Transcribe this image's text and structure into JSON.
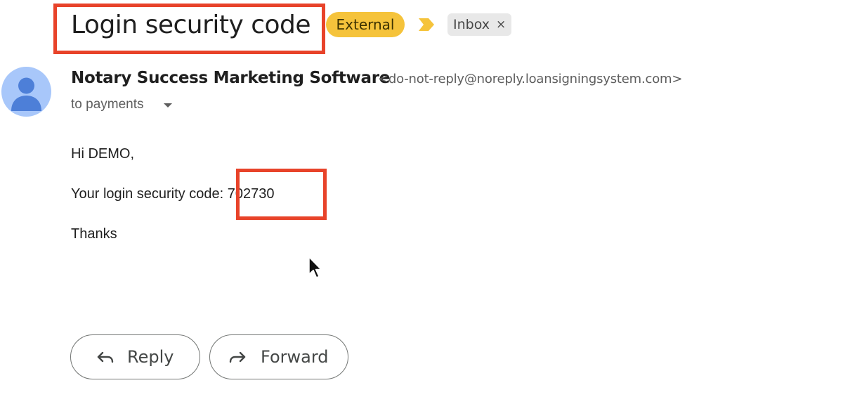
{
  "email": {
    "subject": "Login security code",
    "labels": {
      "external": "External",
      "inbox": "Inbox",
      "remove_symbol": "×"
    },
    "sender": {
      "name": "Notary Success Marketing Software",
      "email": "<do-not-reply@noreply.loansigningsystem.com>",
      "recipient": "to payments"
    },
    "body": {
      "greeting": "Hi DEMO,",
      "code_prefix": "Your login security code: ",
      "code": "702730",
      "signoff": "Thanks"
    },
    "actions": {
      "reply": "Reply",
      "forward": "Forward"
    }
  },
  "colors": {
    "highlight": "#e8432a",
    "external_label": "#f5c33b",
    "importance_marker": "#f5c33b",
    "avatar": "#a8c7fa",
    "avatar_person": "#4d7fd8"
  },
  "icons": {
    "avatar": "person-icon",
    "importance": "importance-marker-icon",
    "dropdown": "chevron-down-icon",
    "reply": "reply-arrow-icon",
    "forward": "forward-arrow-icon",
    "cursor": "mouse-pointer-icon"
  }
}
